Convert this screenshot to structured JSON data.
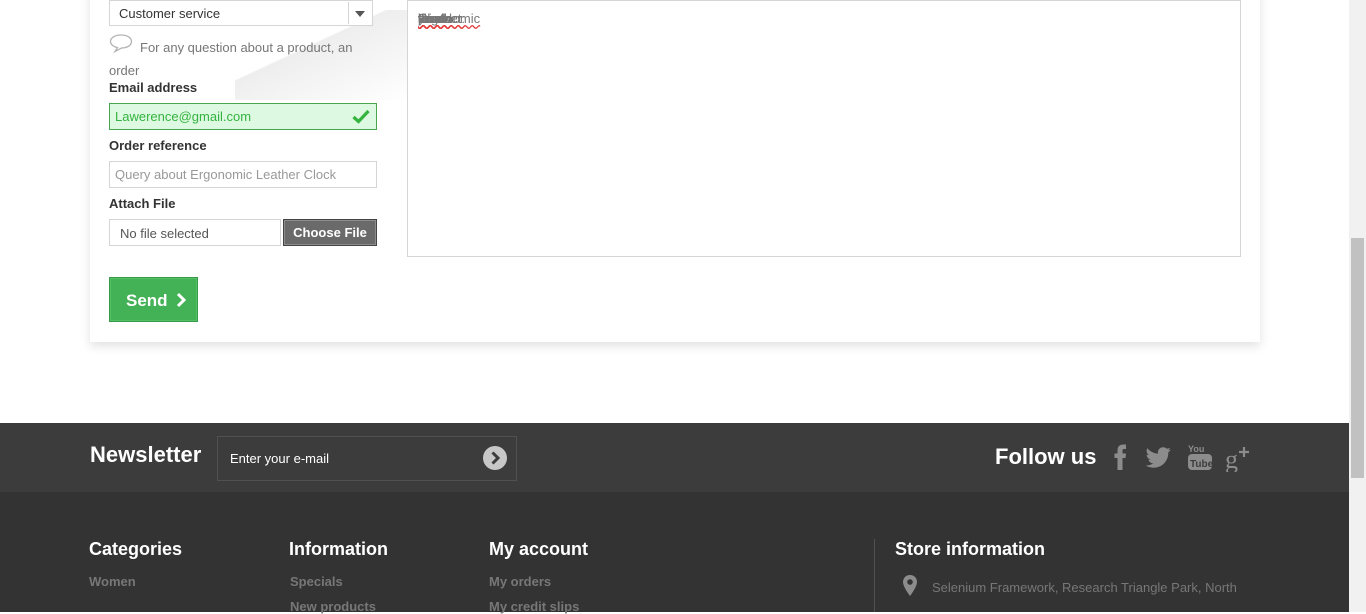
{
  "contact_form": {
    "subject_select": {
      "selected": "Customer service"
    },
    "subject_hint": "For any question about a product, an order",
    "email_label": "Email address",
    "email_value": "Lawerence@gmail.com",
    "order_ref_label": "Order reference",
    "order_ref_placeholder": "Query about Ergonomic Leather Clock",
    "attach_label": "Attach File",
    "file_status": "No file selected",
    "choose_file_label": "Choose File",
    "send_label": "Send",
    "message_words": [
      "I",
      "would",
      "like",
      "to",
      "know",
      "if",
      "you",
      "have",
      "this",
      "product:",
      "Ergonomic",
      "Leather",
      "Clock"
    ]
  },
  "newsletter": {
    "title": "Newsletter",
    "input_placeholder": "Enter your e-mail"
  },
  "social": {
    "title": "Follow us",
    "icons": [
      "facebook-icon",
      "twitter-icon",
      "youtube-icon",
      "google-plus-icon"
    ]
  },
  "footer": {
    "categories": {
      "title": "Categories",
      "links": [
        "Women"
      ]
    },
    "information": {
      "title": "Information",
      "links": [
        "Specials",
        "New products"
      ]
    },
    "my_account": {
      "title": "My account",
      "links": [
        "My orders",
        "My credit slips"
      ]
    },
    "store_information": {
      "title": "Store information",
      "address": "Selenium Framework, Research Triangle Park, North"
    }
  },
  "colors": {
    "success_green": "#43b155",
    "email_valid_bg": "#ddf9e1",
    "newsletter_bg": "#3c3c3c",
    "footer_bg": "#333333"
  }
}
